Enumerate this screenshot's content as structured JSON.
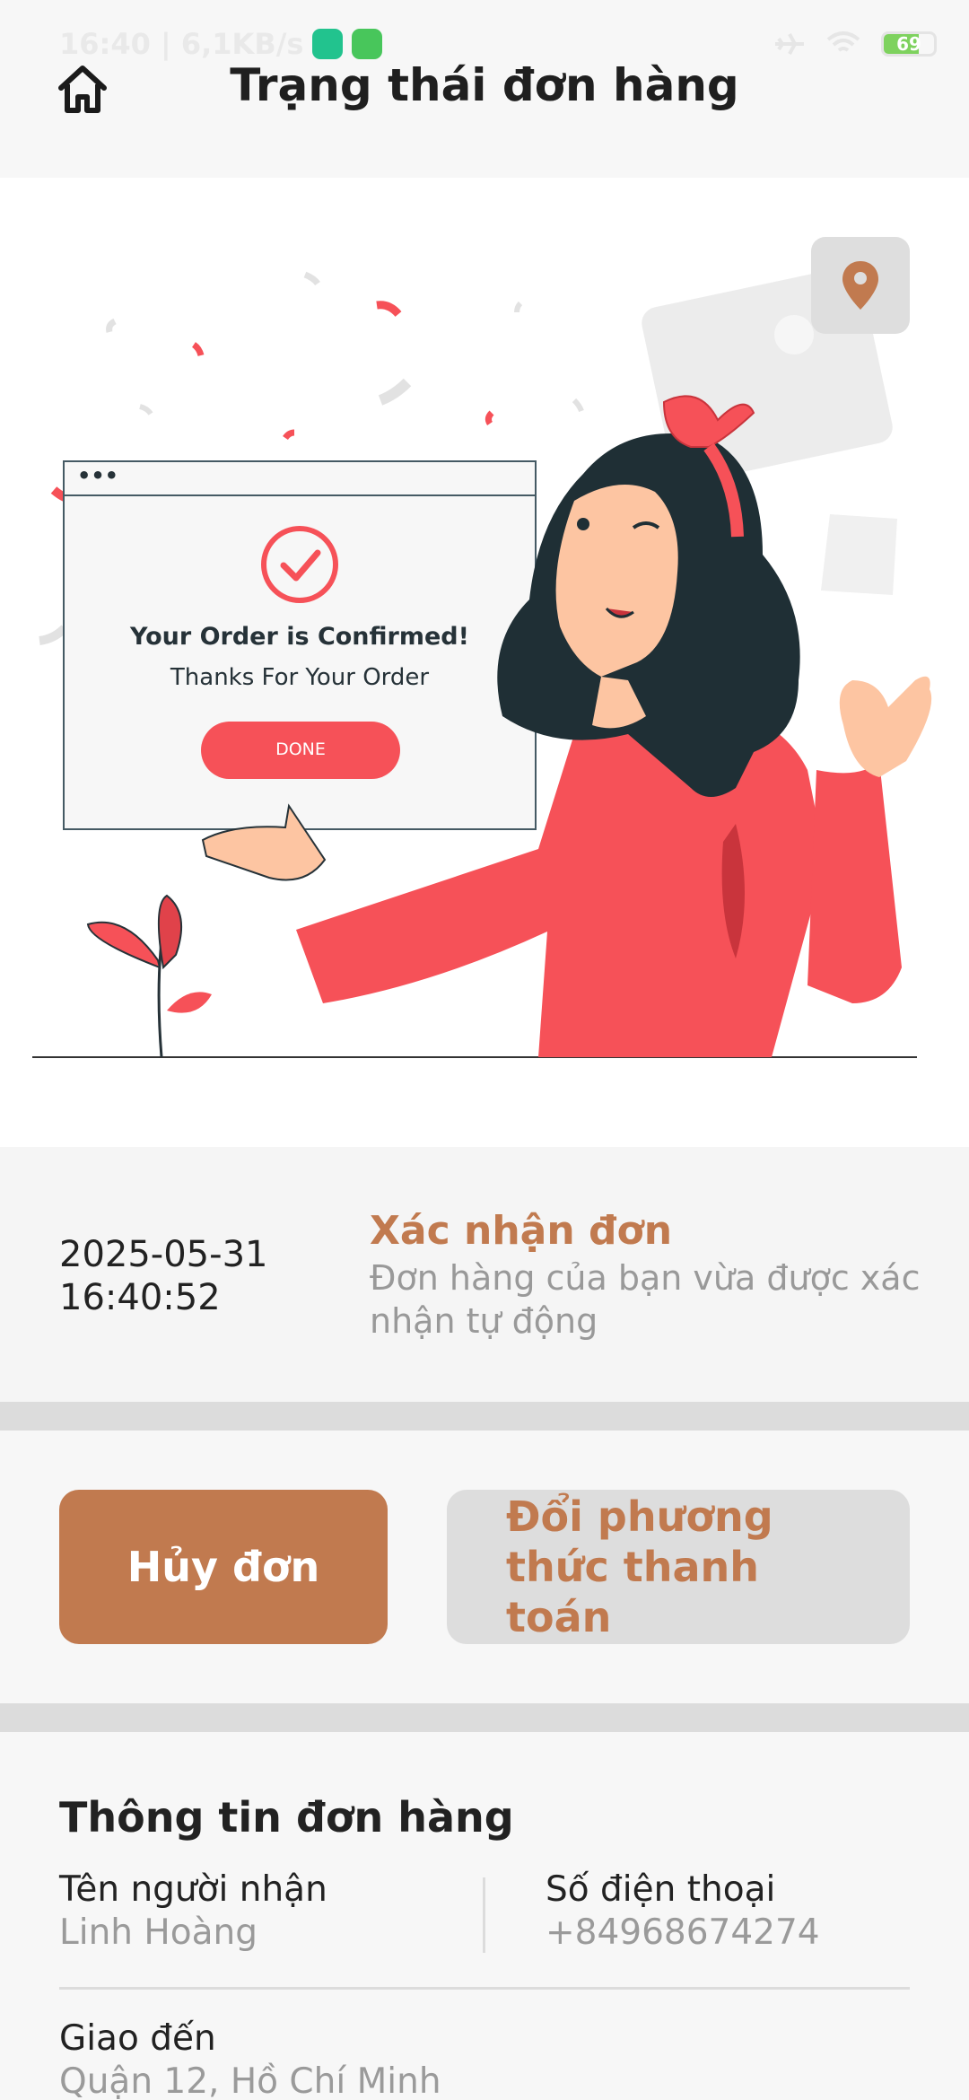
{
  "status_bar": {
    "time_speed": "16:40 | 6,1KB/s",
    "battery": "69",
    "battery_level": 0.69
  },
  "header": {
    "title": "Trạng thái đơn hàng"
  },
  "illustration": {
    "card_title": "Your Order is Confirmed!",
    "card_subtitle": "Thanks For Your Order",
    "card_button": "DONE",
    "window_dots": "•••"
  },
  "timeline": {
    "date": "2025-05-31",
    "time": "16:40:52",
    "status": "Xác nhận đơn",
    "description": "Đơn hàng của bạn vừa được xác nhận tự động"
  },
  "actions": {
    "cancel_label": "Hủy đơn",
    "change_payment_label": "Đổi phương thức thanh toán"
  },
  "order_info": {
    "title": "Thông tin đơn hàng",
    "recipient_label": "Tên người nhận",
    "recipient_value": "Linh Hoàng",
    "phone_label": "Số điện thoại",
    "phone_value": "+84968674274",
    "address_label": "Giao đến",
    "address_value": "Quận 12, Hồ Chí Minh"
  },
  "colors": {
    "accent": "#c17a4f",
    "illustration_red": "#f65158",
    "hair": "#1f2f35",
    "skin": "#fdc5a2"
  }
}
